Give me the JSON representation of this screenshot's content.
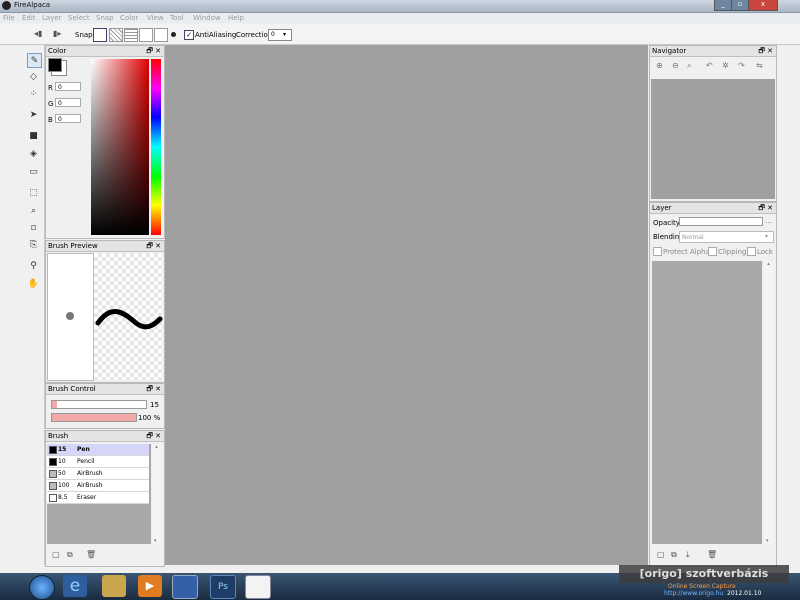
{
  "window": {
    "title": "FireAlpaca",
    "min": "_",
    "max": "▫",
    "close": "x"
  },
  "menu": [
    "File",
    "Edit",
    "Layer",
    "Select",
    "Snap",
    "Color",
    "View",
    "Tool",
    "Window",
    "Help"
  ],
  "toolbar": {
    "snap_label": "Snap",
    "antialias_label": "AntiAliasing",
    "antialias_checked": true,
    "correction_label": "Correction",
    "correction_value": "0"
  },
  "color_panel": {
    "title": "Color",
    "r_label": "R",
    "r_value": "0",
    "g_label": "G",
    "g_value": "0",
    "b_label": "B",
    "b_value": "0",
    "primary": "#000000",
    "secondary": "#ffffff"
  },
  "brush_preview": {
    "title": "Brush Preview"
  },
  "brush_control": {
    "title": "Brush Control",
    "size_value": "15",
    "opacity_value": "100 %",
    "size_fraction": 0.05,
    "opacity_fraction": 1.0
  },
  "brush_panel": {
    "title": "Brush",
    "items": [
      {
        "size": "15",
        "name": "Pen",
        "selected": true,
        "swatch": "#000000"
      },
      {
        "size": "10",
        "name": "Pencil",
        "selected": false,
        "swatch": "#000000"
      },
      {
        "size": "50",
        "name": "AirBrush",
        "selected": false,
        "swatch": "#bbbbbb"
      },
      {
        "size": "100",
        "name": "AirBrush",
        "selected": false,
        "swatch": "#bbbbbb"
      },
      {
        "size": "8.5",
        "name": "Eraser",
        "selected": false,
        "swatch": "#ffffff"
      }
    ]
  },
  "navigator": {
    "title": "Navigator"
  },
  "layer_panel": {
    "title": "Layer",
    "opacity_label": "Opacity",
    "blending_label": "Blending",
    "blending_value": "Normal",
    "protect_alpha_label": "Protect Alpha",
    "clipping_label": "Clipping",
    "lock_label": "Lock"
  },
  "taskbar": {
    "watermark_top": "[origo] szoftverbázis",
    "watermark_mid": "Online Screen Capture",
    "watermark_url": "http://www.origo.hu",
    "clock": "2012.01.10"
  }
}
